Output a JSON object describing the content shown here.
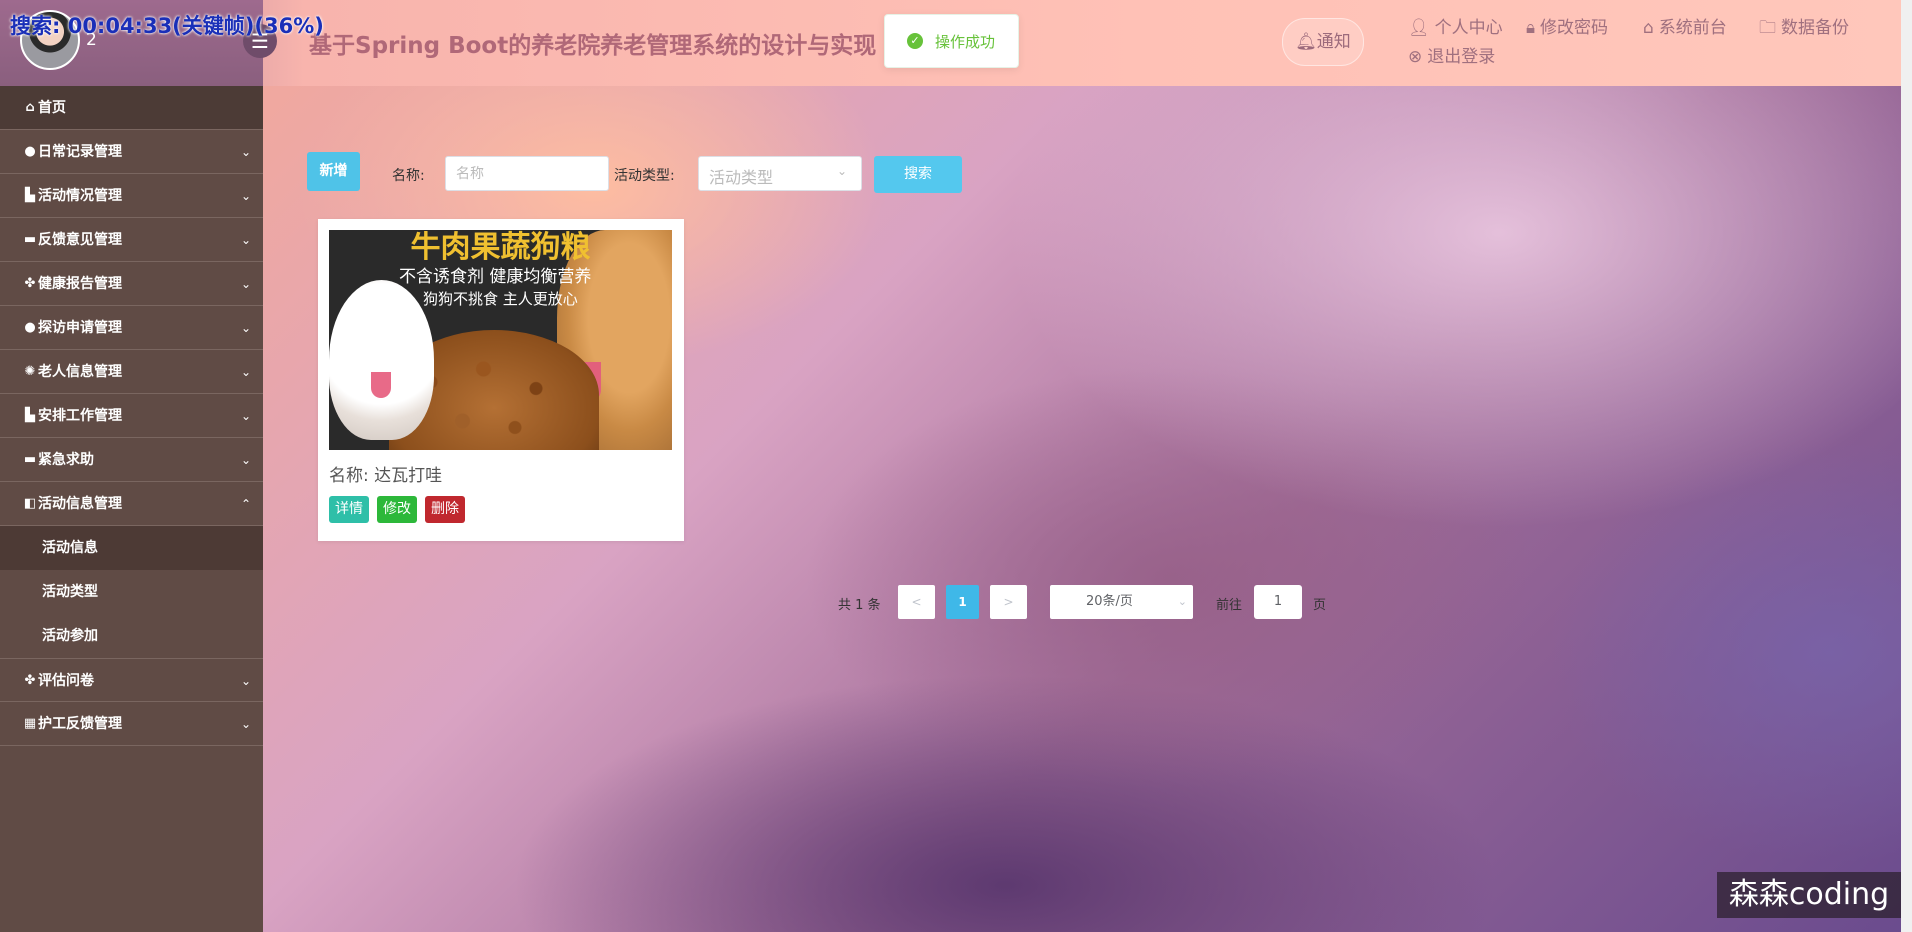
{
  "overlay": {
    "search_status": "搜索: 00:04:33(关键帧)(36%)"
  },
  "header": {
    "user_number": "2",
    "title": "基于Spring Boot的养老院养老管理系统的设计与实现",
    "toast": "操作成功",
    "notify": "通知",
    "links": {
      "profile": "个人中心",
      "change_password": "修改密码",
      "frontend": "系统前台",
      "backup": "数据备份",
      "logout": "退出登录"
    }
  },
  "sidebar": {
    "home": "首页",
    "items": [
      {
        "label": "日常记录管理",
        "icon": "circle-icon"
      },
      {
        "label": "活动情况管理",
        "icon": "folder-icon"
      },
      {
        "label": "反馈意见管理",
        "icon": "card-icon"
      },
      {
        "label": "健康报告管理",
        "icon": "grid-icon"
      },
      {
        "label": "探访申请管理",
        "icon": "circle-icon"
      },
      {
        "label": "老人信息管理",
        "icon": "gear-icon"
      },
      {
        "label": "安排工作管理",
        "icon": "folder-icon"
      },
      {
        "label": "紧急求助",
        "icon": "card-icon"
      },
      {
        "label": "活动信息管理",
        "icon": "doc-icon"
      }
    ],
    "submenu": [
      "活动信息",
      "活动类型",
      "活动参加"
    ],
    "after": [
      {
        "label": "评估问卷",
        "icon": "grid-icon"
      },
      {
        "label": "护工反馈管理",
        "icon": "grid-icon"
      }
    ]
  },
  "toolbar": {
    "add": "新增",
    "name_label": "名称:",
    "name_placeholder": "名称",
    "type_label": "活动类型:",
    "type_placeholder": "活动类型",
    "search": "搜索"
  },
  "card": {
    "image_text": {
      "top": "牛肉果蔬狗粮",
      "line1": "不含诱食剂 健康均衡营养",
      "line2": "狗狗不挑食 主人更放心"
    },
    "name": "名称: 达瓦打哇",
    "buttons": {
      "detail": "详情",
      "edit": "修改",
      "delete": "删除"
    }
  },
  "pagination": {
    "total": "共 1 条",
    "prev": "<",
    "current": "1",
    "next": ">",
    "page_size": "20条/页",
    "goto": "前往",
    "goto_value": "1",
    "page_unit": "页"
  },
  "watermark": "森森coding",
  "colors": {
    "sidebar_bg": "#604b45",
    "accent_blue": "#54c8ee",
    "detail_green": "#2ebfa8",
    "edit_green": "#2db83a",
    "delete_red": "#c0282e",
    "toast_green": "#67c23a"
  }
}
